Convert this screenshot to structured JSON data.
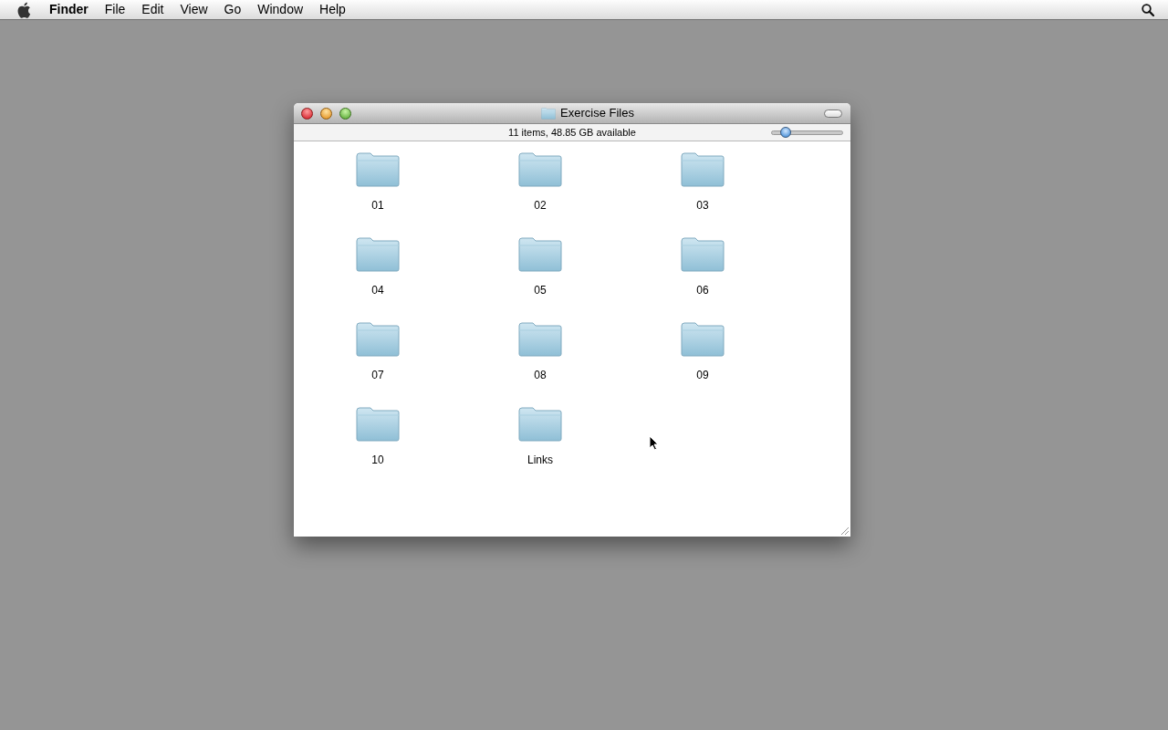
{
  "menu_bar": {
    "items": [
      {
        "label": "Finder",
        "kind": "app"
      },
      {
        "label": "File",
        "kind": "menu"
      },
      {
        "label": "Edit",
        "kind": "menu"
      },
      {
        "label": "View",
        "kind": "menu"
      },
      {
        "label": "Go",
        "kind": "menu"
      },
      {
        "label": "Window",
        "kind": "menu"
      },
      {
        "label": "Help",
        "kind": "menu"
      }
    ]
  },
  "window": {
    "title": "Exercise Files",
    "status": "11 items, 48.85 GB available",
    "icon_size_slider": {
      "level": 0.2
    },
    "items": [
      {
        "name": "01"
      },
      {
        "name": "02"
      },
      {
        "name": "03"
      },
      {
        "name": "04"
      },
      {
        "name": "05"
      },
      {
        "name": "06"
      },
      {
        "name": "07"
      },
      {
        "name": "08"
      },
      {
        "name": "09"
      },
      {
        "name": "10"
      },
      {
        "name": "Links"
      }
    ]
  }
}
